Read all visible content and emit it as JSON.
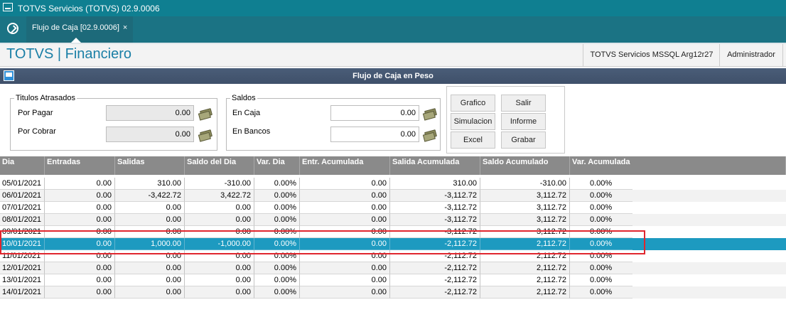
{
  "window": {
    "title": "TOTVS Servicios (TOTVS) 02.9.0006"
  },
  "tab": {
    "label": "Flujo de Caja [02.9.0006]",
    "close": "×"
  },
  "header": {
    "brand": "TOTVS | Financiero",
    "server": "TOTVS Servicios MSSQL Arg12r27",
    "user": "Administrador"
  },
  "dialog": {
    "title": "Flujo de Caja en  Peso"
  },
  "titulos": {
    "legend": "Titulos Atrasados",
    "por_pagar_label": "Por Pagar",
    "por_pagar_value": "0.00",
    "por_cobrar_label": "Por Cobrar",
    "por_cobrar_value": "0.00"
  },
  "saldos": {
    "legend": "Saldos",
    "en_caja_label": "En Caja",
    "en_caja_value": "0.00",
    "en_bancos_label": "En Bancos",
    "en_bancos_value": "0.00"
  },
  "buttons": {
    "grafico": "Grafico",
    "salir": "Salir",
    "simulacion": "Simulacion",
    "informe": "Informe",
    "excel": "Excel",
    "grabar": "Grabar"
  },
  "icons": {
    "money": "money-icon",
    "home": "home-icon",
    "window": "window-icon"
  },
  "colors": {
    "titlebar": "#0f7f91",
    "tabbar": "#1b7384",
    "selected_row": "#1d9ac0",
    "highlight": "#e0262e",
    "brand": "#1a7fa6"
  },
  "table": {
    "columns": [
      "Dia",
      "Entradas",
      "Salidas",
      "Saldo del Dia",
      "Var. Dia",
      "Entr. Acumulada",
      "Salida Acumulada",
      "Saldo Acumulado",
      "Var. Acumulada"
    ],
    "rows": [
      [
        "05/01/2021",
        "0.00",
        "310.00",
        "-310.00",
        "0.00%",
        "0.00",
        "310.00",
        "-310.00",
        "0.00%"
      ],
      [
        "06/01/2021",
        "0.00",
        "-3,422.72",
        "3,422.72",
        "0.00%",
        "0.00",
        "-3,112.72",
        "3,112.72",
        "0.00%"
      ],
      [
        "07/01/2021",
        "0.00",
        "0.00",
        "0.00",
        "0.00%",
        "0.00",
        "-3,112.72",
        "3,112.72",
        "0.00%"
      ],
      [
        "08/01/2021",
        "0.00",
        "0.00",
        "0.00",
        "0.00%",
        "0.00",
        "-3,112.72",
        "3,112.72",
        "0.00%"
      ],
      [
        "09/01/2021",
        "0.00",
        "0.00",
        "0.00",
        "0.00%",
        "0.00",
        "-3,112.72",
        "3,112.72",
        "0.00%"
      ],
      [
        "10/01/2021",
        "0.00",
        "1,000.00",
        "-1,000.00",
        "0.00%",
        "0.00",
        "-2,112.72",
        "2,112.72",
        "0.00%"
      ],
      [
        "11/01/2021",
        "0.00",
        "0.00",
        "0.00",
        "0.00%",
        "0.00",
        "-2,112.72",
        "2,112.72",
        "0.00%"
      ],
      [
        "12/01/2021",
        "0.00",
        "0.00",
        "0.00",
        "0.00%",
        "0.00",
        "-2,112.72",
        "2,112.72",
        "0.00%"
      ],
      [
        "13/01/2021",
        "0.00",
        "0.00",
        "0.00",
        "0.00%",
        "0.00",
        "-2,112.72",
        "2,112.72",
        "0.00%"
      ],
      [
        "14/01/2021",
        "0.00",
        "0.00",
        "0.00",
        "0.00%",
        "0.00",
        "-2,112.72",
        "2,112.72",
        "0.00%"
      ]
    ],
    "selected_row": 5
  }
}
